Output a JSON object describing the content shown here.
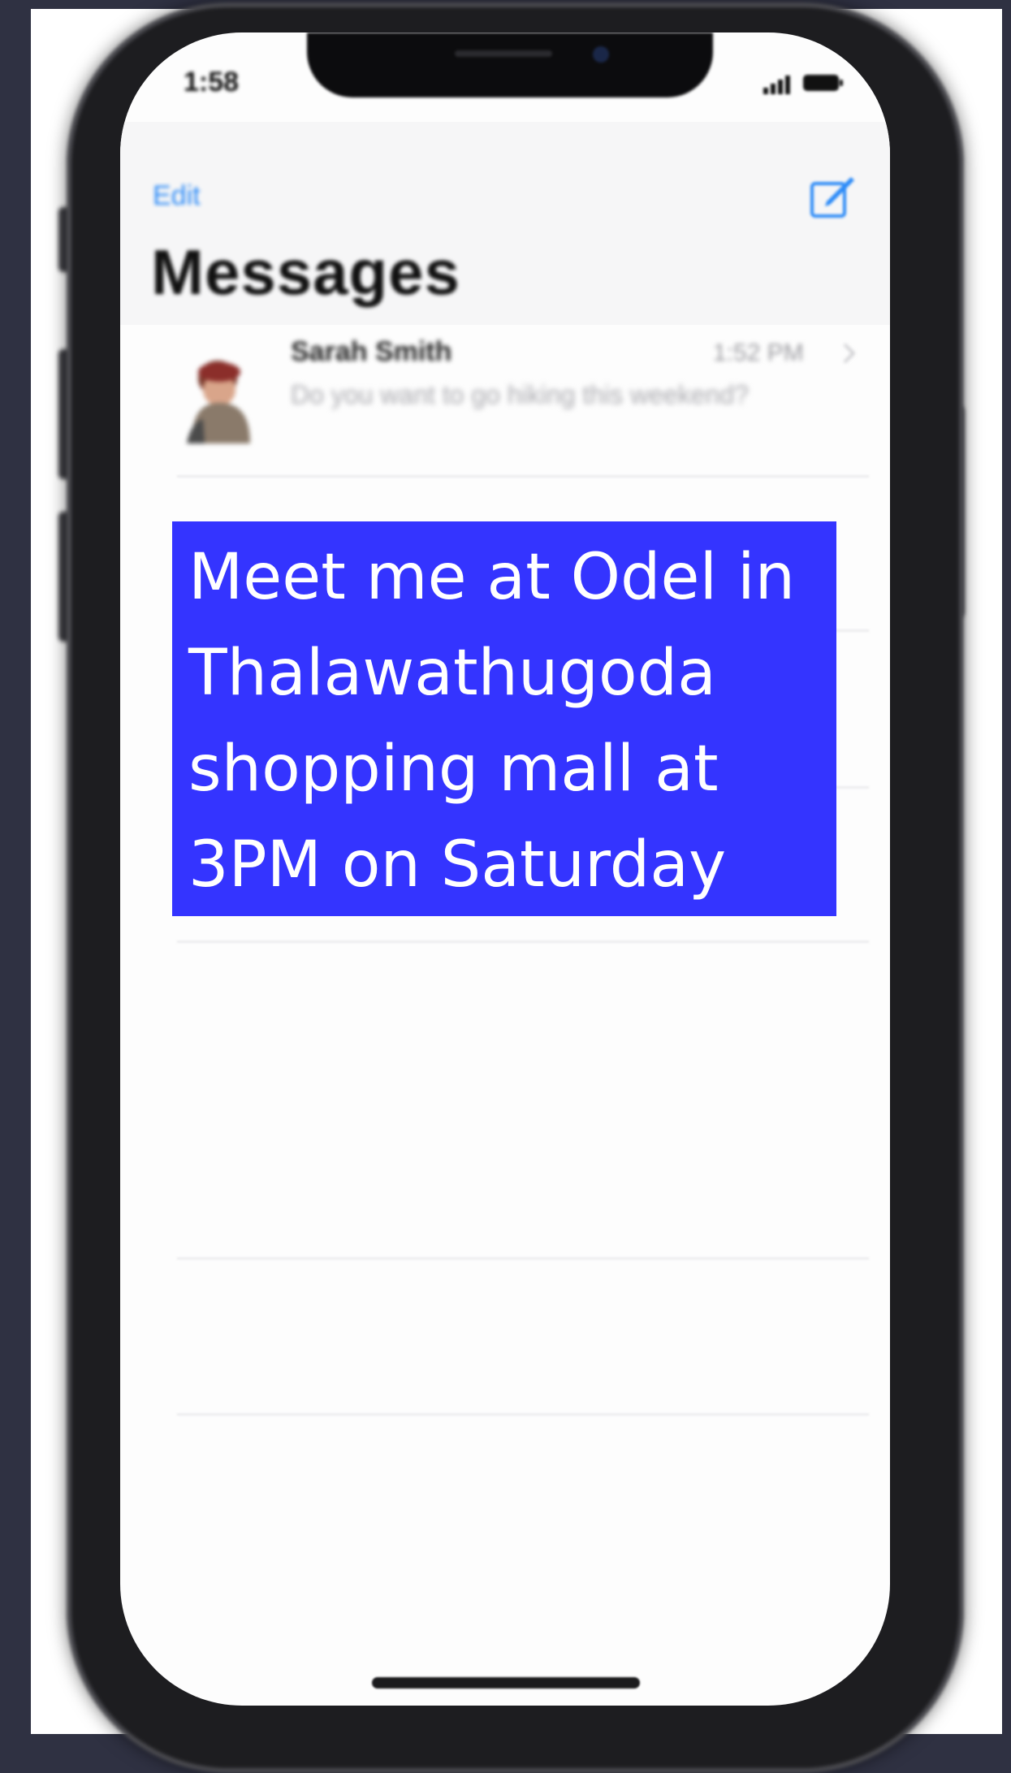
{
  "status_bar": {
    "time": "1:58"
  },
  "nav": {
    "edit_label": "Edit",
    "title": "Messages",
    "compose_icon": "compose-icon"
  },
  "conversation": {
    "contact_name": "Sarah Smith",
    "time": "1:52 PM",
    "preview": "Do you want to go hiking this weekend?"
  },
  "overlay": {
    "lines": [
      "Meet me at Odel in",
      "Thalawathugoda",
      "shopping mall at",
      "3PM on Saturday"
    ],
    "background_color": "#3434ff",
    "text_color": "#ffffff"
  },
  "colors": {
    "page_background": "#2f3142",
    "ios_blue": "#2b8af7"
  }
}
